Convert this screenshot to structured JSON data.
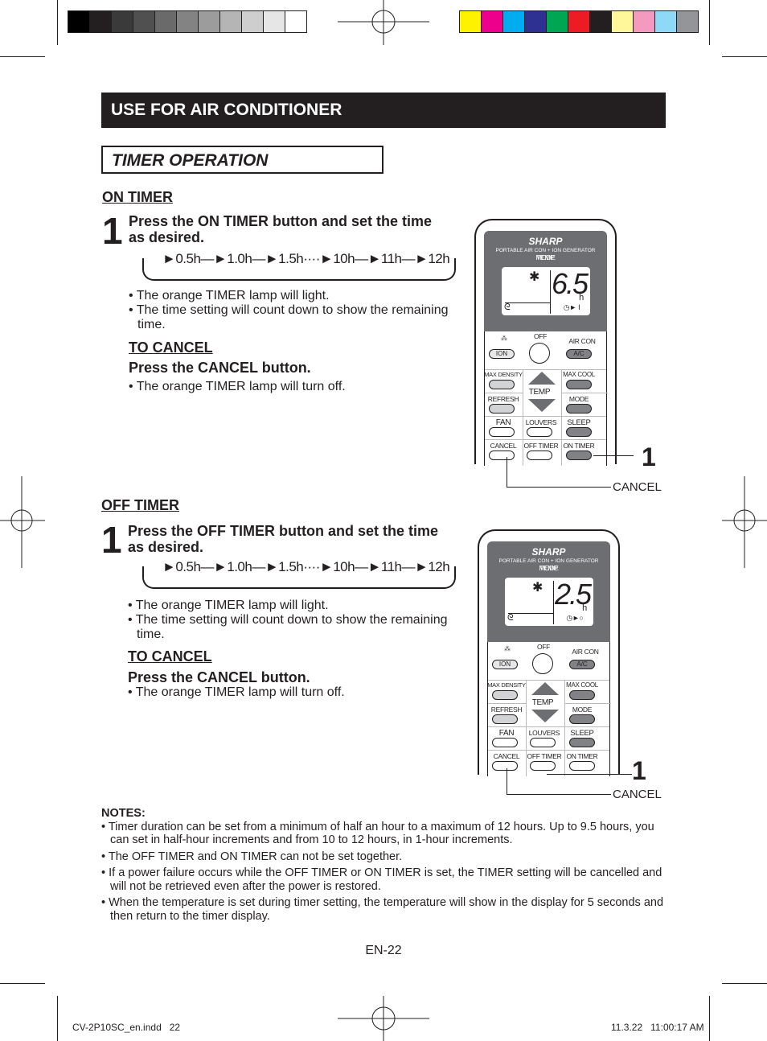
{
  "registration": {
    "grays": [
      "#000000",
      "#231f20",
      "#3a3a3a",
      "#505050",
      "#6a6a6a",
      "#838383",
      "#9c9c9c",
      "#b5b5b5",
      "#cecece",
      "#e6e6e6",
      "#ffffff"
    ],
    "colors": [
      "#fff200",
      "#ec008c",
      "#00aeef",
      "#2e3192",
      "#00a651",
      "#ed1c24",
      "#231f20",
      "#fff799",
      "#f49ac1",
      "#8ed8f8",
      "#939598"
    ]
  },
  "header": {
    "title": "USE FOR AIR CONDITIONER"
  },
  "subheader": {
    "title": "TIMER OPERATION"
  },
  "on_timer": {
    "heading": "ON TIMER",
    "step_number": "1",
    "step_text": "Press the ON TIMER button and set the time as desired.",
    "sequence": "►0.5h—►1.0h—►1.5h····►10h—►11h—►12h",
    "bullets": [
      "• The orange TIMER lamp will light.",
      "• The time setting will count down to show the remaining time."
    ],
    "cancel_heading": "TO CANCEL",
    "cancel_step": "Press the CANCEL button.",
    "cancel_bullet": "• The orange TIMER lamp will turn off.",
    "callout_number": "1",
    "callout_cancel": "CANCEL"
  },
  "off_timer": {
    "heading": "OFF TIMER",
    "step_number": "1",
    "step_text": "Press the OFF TIMER button and set the time as desired.",
    "sequence": "►0.5h—►1.0h—►1.5h····►10h—►11h—►12h",
    "bullets": [
      "• The orange TIMER lamp will light.",
      "• The time setting will count down to show the remaining time."
    ],
    "cancel_heading": "TO CANCEL",
    "cancel_step": "Press the CANCEL button.",
    "cancel_bullet": "• The orange TIMER lamp will turn off.",
    "callout_number": "1",
    "callout_cancel": "CANCEL"
  },
  "remotes": [
    {
      "brand": "SHARP",
      "tagline": "PORTABLE AIR CON + ION GENERATOR",
      "mode": "MODE",
      "temp": "TEMP",
      "fan": "FAN",
      "timer": "TIMER",
      "display": "6.5",
      "unit": "h",
      "timer_indicator": "◷► I",
      "off": "OFF",
      "ion": "ION",
      "aircon": "AIR CON",
      "ac": "A/C",
      "max_density": "MAX DENSITY",
      "max_cool": "MAX COOL",
      "temp_btn": "TEMP",
      "refresh": "REFRESH",
      "mode_btn": "MODE",
      "fan_btn": "FAN",
      "louvers": "LOUVERS",
      "sleep": "SLEEP",
      "cancel": "CANCEL",
      "off_timer": "OFF TIMER",
      "on_timer": "ON TIMER"
    },
    {
      "brand": "SHARP",
      "tagline": "PORTABLE AIR CON + ION GENERATOR",
      "mode": "MODE",
      "temp": "TEMP",
      "fan": "FAN",
      "timer": "TIMER",
      "display": "2.5",
      "unit": "h",
      "timer_indicator": "◷►○",
      "off": "OFF",
      "ion": "ION",
      "aircon": "AIR CON",
      "ac": "A/C",
      "max_density": "MAX DENSITY",
      "max_cool": "MAX COOL",
      "temp_btn": "TEMP",
      "refresh": "REFRESH",
      "mode_btn": "MODE",
      "fan_btn": "FAN",
      "louvers": "LOUVERS",
      "sleep": "SLEEP",
      "cancel": "CANCEL",
      "off_timer": "OFF TIMER",
      "on_timer": "ON TIMER"
    }
  ],
  "notes": {
    "title": "NOTES:",
    "items": [
      "• Timer duration can be set from a minimum of half an hour to a maximum of 12 hours. Up to 9.5 hours, you can set in half-hour increments and from 10 to 12 hours, in 1-hour increments.",
      "• The OFF TIMER and ON TIMER can not be set together.",
      "• If a power failure occurs while the OFF TIMER or ON TIMER is set, the TIMER setting will be cancelled and will not be retrieved even after the power is restored.",
      "• When the temperature is set during timer setting, the temperature will show in the display for 5 seconds and then return to the timer display."
    ]
  },
  "page_number": "EN-22",
  "footer": {
    "file": "CV-2P10SC_en.indd   22",
    "timestamp": "11.3.22   11:00:17 AM"
  }
}
